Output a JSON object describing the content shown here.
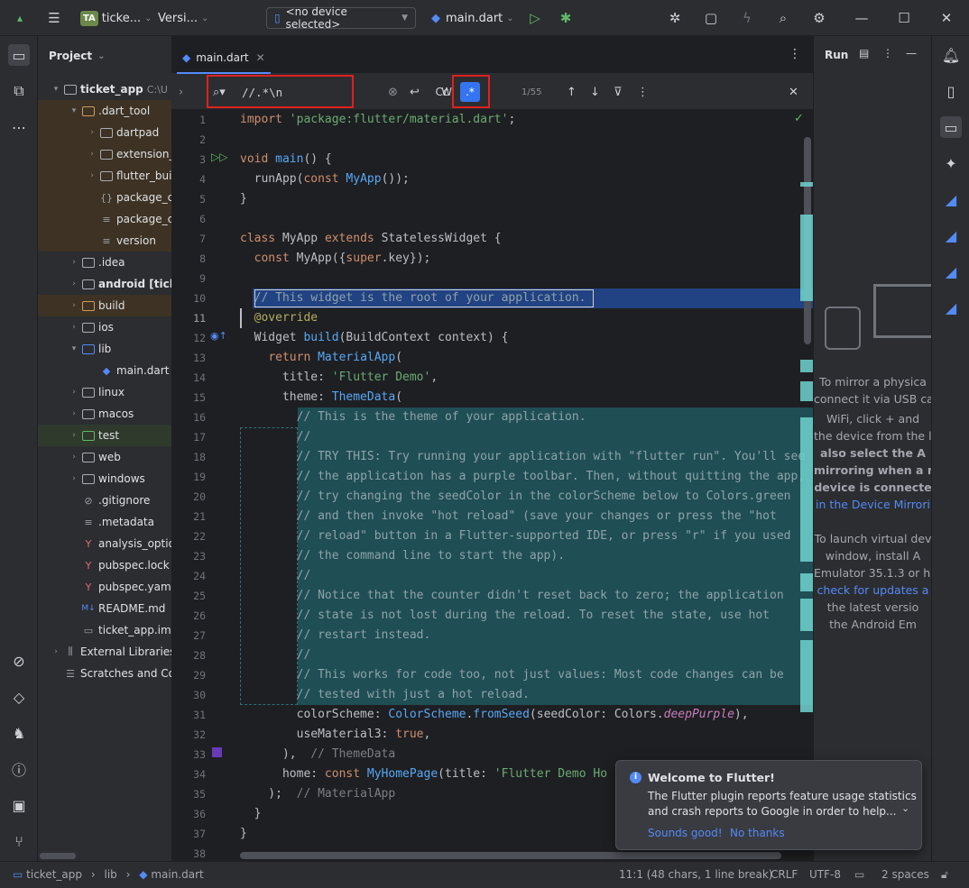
{
  "titlebar": {
    "project_badge": "TA",
    "project_name": "ticke...",
    "vcs_label": "Versi...",
    "device_selector": "<no device selected>",
    "run_config": "main.dart"
  },
  "project_panel": {
    "title": "Project",
    "root": {
      "name": "ticket_app",
      "path": "C:\\U"
    },
    "items": [
      {
        "label": ".dart_tool",
        "indent": 1,
        "expanded": true
      },
      {
        "label": "dartpad",
        "indent": 2
      },
      {
        "label": "extension_",
        "indent": 2
      },
      {
        "label": "flutter_buil",
        "indent": 2
      },
      {
        "label": "package_co",
        "indent": 2
      },
      {
        "label": "package_co",
        "indent": 2
      },
      {
        "label": "version",
        "indent": 2
      },
      {
        "label": ".idea",
        "indent": 1
      },
      {
        "label": "android [ticke",
        "indent": 1
      },
      {
        "label": "build",
        "indent": 1
      },
      {
        "label": "ios",
        "indent": 1
      },
      {
        "label": "lib",
        "indent": 1,
        "expanded": true
      },
      {
        "label": "main.dart",
        "indent": 2
      },
      {
        "label": "linux",
        "indent": 1
      },
      {
        "label": "macos",
        "indent": 1
      },
      {
        "label": "test",
        "indent": 1
      },
      {
        "label": "web",
        "indent": 1
      },
      {
        "label": "windows",
        "indent": 1
      },
      {
        "label": ".gitignore",
        "indent": 1
      },
      {
        "label": ".metadata",
        "indent": 1
      },
      {
        "label": "analysis_option",
        "indent": 1
      },
      {
        "label": "pubspec.lock",
        "indent": 1
      },
      {
        "label": "pubspec.yaml",
        "indent": 1
      },
      {
        "label": "README.md",
        "indent": 1
      },
      {
        "label": "ticket_app.iml",
        "indent": 1
      },
      {
        "label": "External Libraries",
        "indent": 0
      },
      {
        "label": "Scratches and Co",
        "indent": 0
      }
    ]
  },
  "editor": {
    "tab_label": "main.dart",
    "find": {
      "query": "//.*\\n",
      "case_label": "Cc",
      "word_label": "W",
      "regex_label": ".*",
      "match_count": "1/55"
    },
    "line_numbers": [
      "1",
      "2",
      "3",
      "4",
      "5",
      "6",
      "7",
      "8",
      "9",
      "10",
      "11",
      "12",
      "13",
      "14",
      "15",
      "16",
      "17",
      "18",
      "19",
      "20",
      "21",
      "22",
      "23",
      "24",
      "25",
      "26",
      "27",
      "28",
      "29",
      "30",
      "31",
      "32",
      "33",
      "34",
      "35",
      "36",
      "37",
      "38"
    ]
  },
  "run_panel": {
    "title": "Run",
    "lines": [
      "To mirror a physica",
      "connect it via USB ca",
      "WiFi, click + and",
      "the device from the li",
      "also select the A",
      "mirroring when a ne",
      "device is connecte",
      "in the Device Mirrori",
      "To launch virtual dev",
      "window, install A",
      "Emulator 35.1.3 or hig",
      "check for updates a",
      "the latest versio",
      "the Android Em"
    ]
  },
  "notification": {
    "title": "Welcome to Flutter!",
    "body_line1": "The Flutter plugin reports feature usage statistics",
    "body_line2": "and crash reports to Google in order to help...",
    "accept": "Sounds good!",
    "decline": "No thanks"
  },
  "statusbar": {
    "crumb_project": "ticket_app",
    "crumb_dir": "lib",
    "crumb_file": "main.dart",
    "position": "11:1 (48 chars, 1 line break)",
    "line_sep": "CRLF",
    "encoding": "UTF-8",
    "indent": "2 spaces"
  },
  "colors": {
    "accent": "#548af7",
    "highlight_red": "#e0201f",
    "match_bg": "#1f4e55"
  }
}
